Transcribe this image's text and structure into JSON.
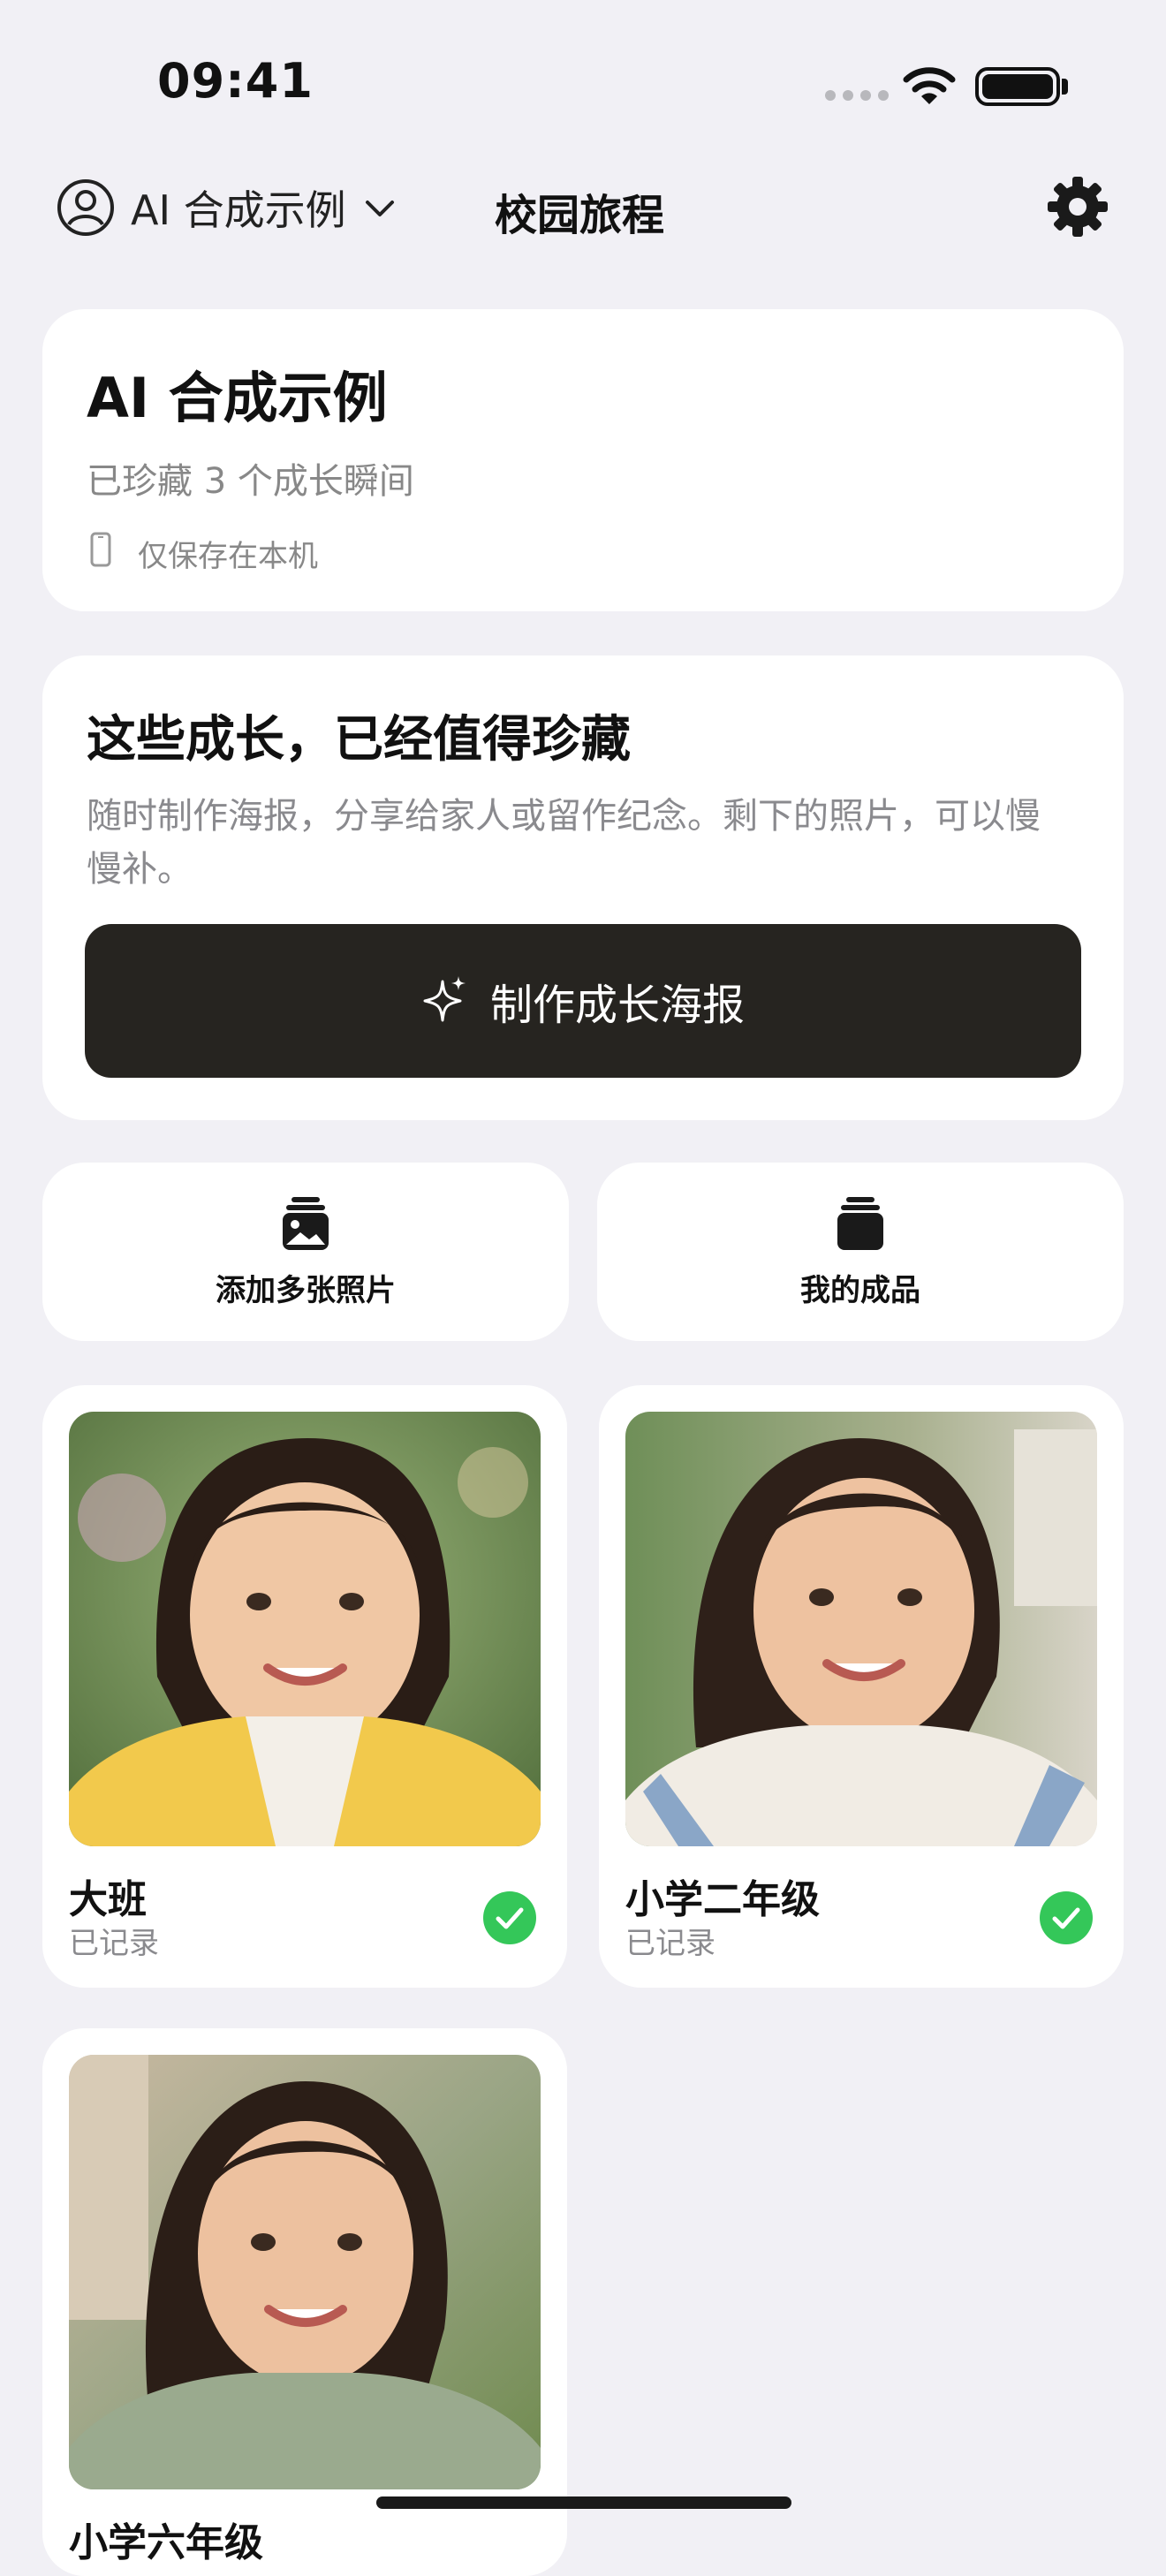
{
  "status_bar": {
    "time": "09:41"
  },
  "header": {
    "profile_name": "AI 合成示例",
    "title": "校园旅程"
  },
  "summary_card": {
    "title": "AI 合成示例",
    "subtitle": "已珍藏 3 个成长瞬间",
    "storage_note": "仅保存在本机"
  },
  "poster_card": {
    "title": "这些成长，已经值得珍藏",
    "body": "随时制作海报，分享给家人或留作纪念。剩下的照片，可以慢慢补。",
    "button_label": "制作成长海报"
  },
  "actions": [
    {
      "label": "添加多张照片",
      "icon": "photo-stack-icon"
    },
    {
      "label": "我的成品",
      "icon": "stack-icon"
    }
  ],
  "photos": [
    {
      "grade": "大班",
      "status": "已记录",
      "done": true
    },
    {
      "grade": "小学二年级",
      "status": "已记录",
      "done": true
    },
    {
      "grade": "小学六年级",
      "status": "",
      "done": false
    }
  ],
  "colors": {
    "background": "#f1f0f5",
    "card": "#ffffff",
    "primary_button": "#262420",
    "check_green": "#34c759",
    "secondary_text": "#8a8a8e"
  }
}
